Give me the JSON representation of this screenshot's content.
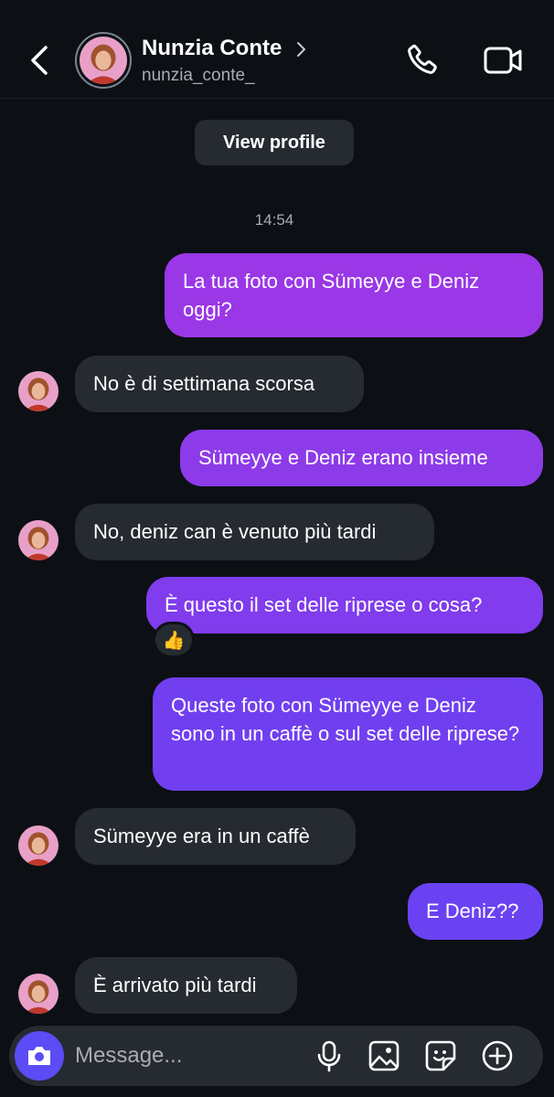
{
  "header": {
    "name": "Nunzia Conte",
    "username": "nunzia_conte_"
  },
  "view_profile_label": "View profile",
  "timestamp": "14:54",
  "messages": [
    {
      "from": "me",
      "text": "La tua foto con Sümeyye e Deniz oggi?"
    },
    {
      "from": "them",
      "text": "No è di settimana scorsa"
    },
    {
      "from": "me",
      "text": "Sümeyye e Deniz erano insieme"
    },
    {
      "from": "them",
      "text": "No, deniz can è venuto più tardi"
    },
    {
      "from": "me",
      "text": "È questo il set delle riprese o cosa?",
      "reaction": "👍"
    },
    {
      "from": "me",
      "text": "Queste foto con Sümeyye e Deniz sono in un caffè o sul set delle riprese?"
    },
    {
      "from": "them",
      "text": "Sümeyye era in un caffè"
    },
    {
      "from": "me",
      "text": "E Deniz??"
    },
    {
      "from": "them",
      "text": "È arrivato più tardi"
    }
  ],
  "composer": {
    "placeholder": "Message..."
  },
  "colors": {
    "background": "#0c1015",
    "incoming_bubble": "#262a31",
    "outgoing_top": "#9b36e6",
    "outgoing_bottom": "#6a3ff2",
    "camera_button": "#5b4cf5"
  }
}
